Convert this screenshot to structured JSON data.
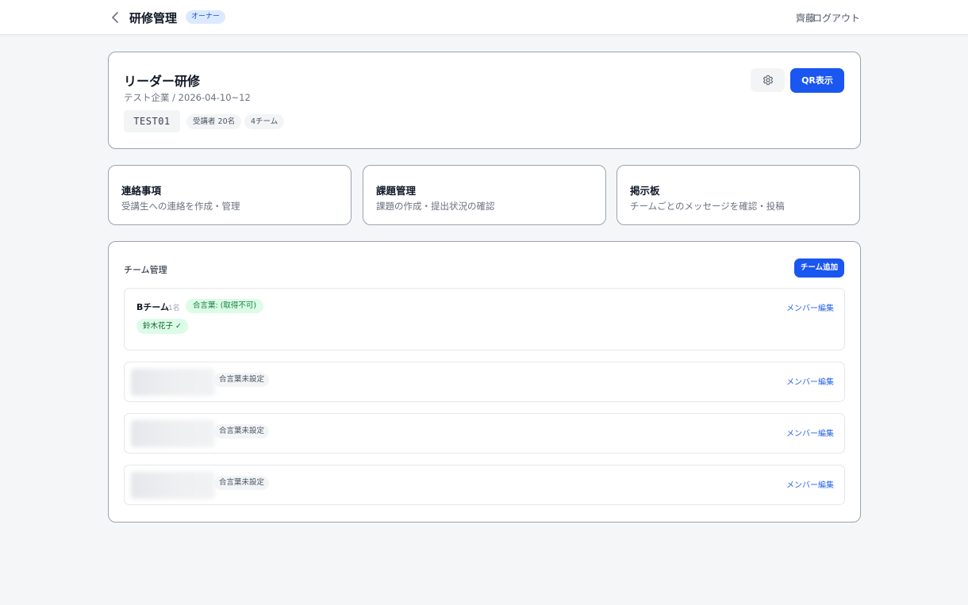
{
  "header": {
    "title": "研修管理",
    "role_badge": "オーナー",
    "user_name": "齊藤",
    "logout_label": "ログアウト"
  },
  "course": {
    "name": "リーダー研修",
    "meta": "テスト企業 / 2026-04-10~12",
    "code": "TEST01",
    "participants": "受講者 20名",
    "teams": "4チーム",
    "qr_label": "QR表示"
  },
  "features": [
    {
      "title": "連絡事項",
      "description": "受講生への連絡を作成・管理"
    },
    {
      "title": "課題管理",
      "description": "課題の作成・提出状況の確認"
    },
    {
      "title": "掲示板",
      "description": "チームごとのメッセージを確認・投稿"
    }
  ],
  "team_management": {
    "heading": "チーム管理",
    "add_label": "チーム追加",
    "edit_label": "メンバー編集",
    "teams": [
      {
        "name": "Bチーム",
        "count": "1名",
        "phrase": "合言葉: (取得不可)",
        "members": [
          "鈴木花子 ✓"
        ]
      },
      {
        "phrase": "合言葉未設定"
      },
      {
        "phrase": "合言葉未設定"
      },
      {
        "phrase": "合言葉未設定"
      }
    ]
  },
  "colors": {
    "accent": "#1a56f0",
    "badge_bg": "#dbeafe",
    "success_bg": "#dcfce7",
    "success_text": "#15803d"
  },
  "icons": {
    "back": "chevron-left-icon",
    "settings": "gear-icon"
  }
}
